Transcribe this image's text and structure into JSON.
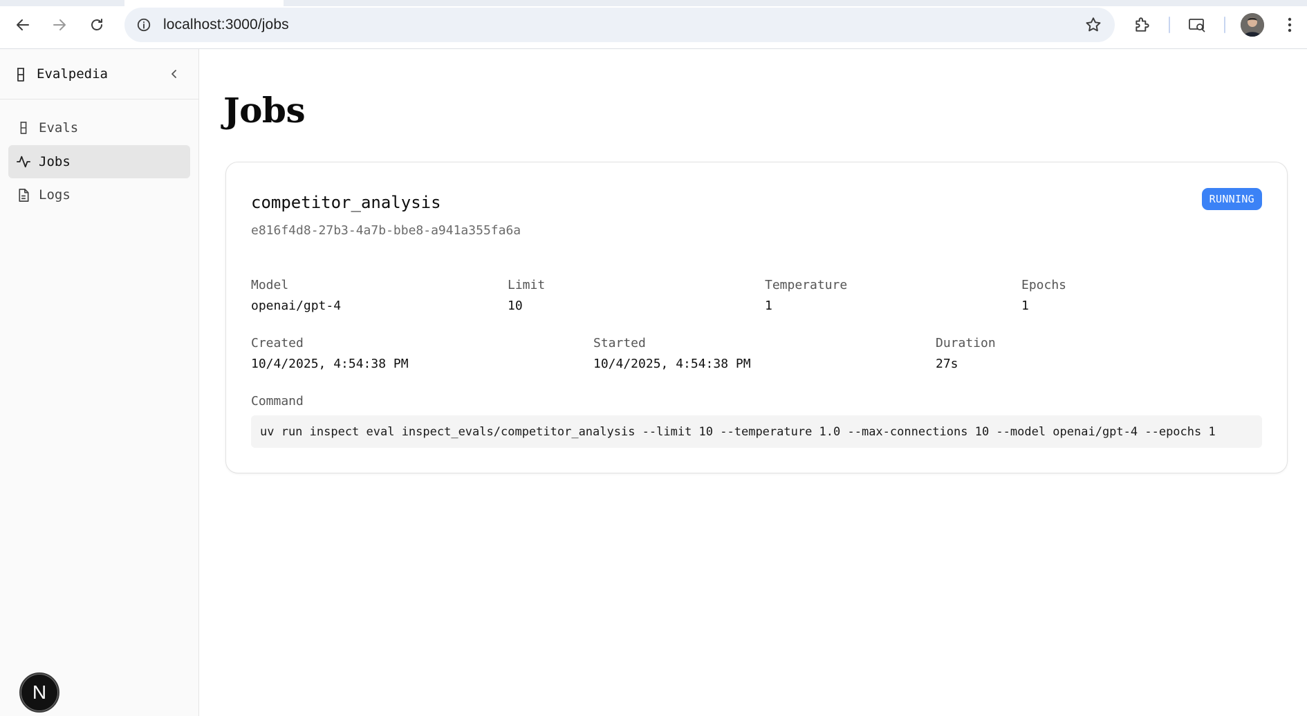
{
  "browser": {
    "url": "localhost:3000/jobs",
    "icons": [
      "back-arrow-icon",
      "forward-arrow-icon",
      "reload-icon",
      "info-icon",
      "star-icon",
      "puzzle-icon",
      "media-search-icon",
      "avatar",
      "kebab-menu-icon"
    ]
  },
  "sidebar": {
    "brand": "Evalpedia",
    "items": [
      {
        "label": "Evals",
        "icon": "flask-icon",
        "active": false
      },
      {
        "label": "Jobs",
        "icon": "activity-icon",
        "active": true
      },
      {
        "label": "Logs",
        "icon": "document-icon",
        "active": false
      }
    ],
    "dev_badge": "N"
  },
  "main": {
    "title": "Jobs",
    "job": {
      "name": "competitor_analysis",
      "id": "e816f4d8-27b3-4a7b-bbe8-a941a355fa6a",
      "status": "RUNNING",
      "status_color": "#3b82f6",
      "fields_row1": [
        {
          "label": "Model",
          "value": "openai/gpt-4"
        },
        {
          "label": "Limit",
          "value": "10"
        },
        {
          "label": "Temperature",
          "value": "1"
        },
        {
          "label": "Epochs",
          "value": "1"
        }
      ],
      "fields_row2": [
        {
          "label": "Created",
          "value": "10/4/2025, 4:54:38 PM"
        },
        {
          "label": "Started",
          "value": "10/4/2025, 4:54:38 PM"
        },
        {
          "label": "Duration",
          "value": "27s"
        }
      ],
      "command_label": "Command",
      "command": "uv run inspect eval inspect_evals/competitor_analysis --limit 10 --temperature 1.0 --max-connections 10 --model openai/gpt-4 --epochs 1"
    }
  }
}
